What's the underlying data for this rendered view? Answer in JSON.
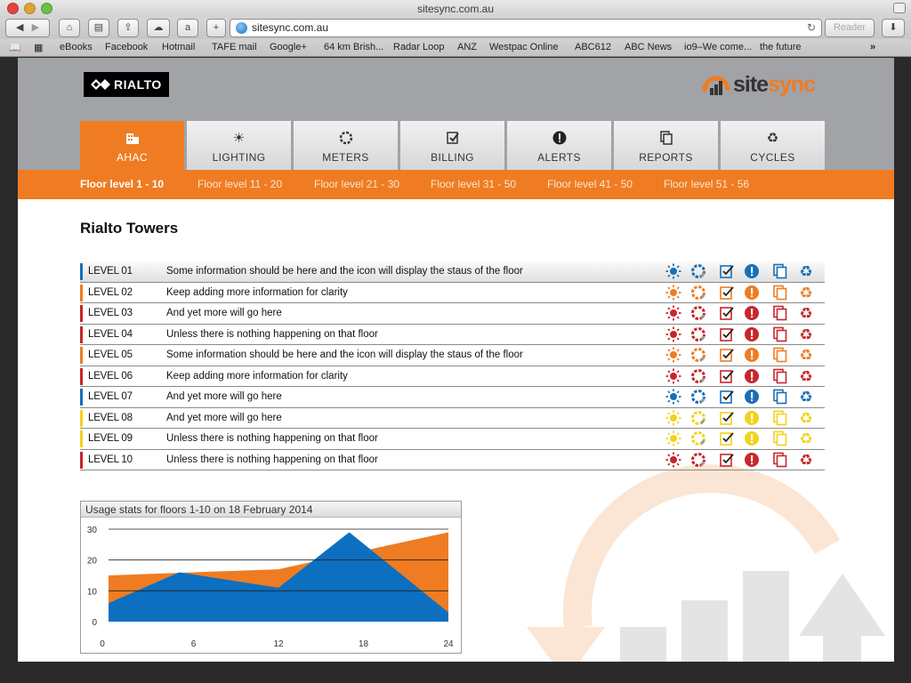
{
  "browser": {
    "window_title": "sitesync.com.au",
    "url": "sitesync.com.au",
    "reader_label": "Reader",
    "bookmarks": [
      "eBooks",
      "Facebook",
      "Hotmail",
      "TAFE mail",
      "Google+",
      "64 km Brish...",
      "Radar Loop",
      "ANZ",
      "Westpac Online",
      "ABC612",
      "ABC News",
      "io9–We come...",
      "the future",
      "»"
    ]
  },
  "header": {
    "client_logo": "RIALTO",
    "brand_logo": {
      "part1": "site",
      "part2": "sync"
    }
  },
  "tabs": [
    {
      "label": "AHAC",
      "icon": "building-icon",
      "active": true
    },
    {
      "label": "LIGHTING",
      "icon": "sun-icon",
      "active": false
    },
    {
      "label": "METERS",
      "icon": "dial-icon",
      "active": false
    },
    {
      "label": "BILLING",
      "icon": "checkbox-icon",
      "active": false
    },
    {
      "label": "ALERTS",
      "icon": "alert-icon",
      "active": false
    },
    {
      "label": "REPORTS",
      "icon": "documents-icon",
      "active": false
    },
    {
      "label": "CYCLES",
      "icon": "recycle-icon",
      "active": false
    }
  ],
  "floor_ranges": [
    "Floor level 1 - 10",
    "Floor level 11 - 20",
    "Floor level 21 - 30",
    "Floor level 31 - 50",
    "Floor level 41 - 50",
    "Floor level 51 - 56"
  ],
  "building_name": "Rialto Towers",
  "levels": [
    {
      "level": "LEVEL 01",
      "info": "Some information should be here and the icon will display the staus of the floor",
      "status_color": "#1a6fb5"
    },
    {
      "level": "LEVEL 02",
      "info": "Keep adding more information for clarity",
      "status_color": "#ef7c22"
    },
    {
      "level": "LEVEL 03",
      "info": "And yet more will go here",
      "status_color": "#c8262b"
    },
    {
      "level": "LEVEL 04",
      "info": "Unless there is nothing happening on that floor",
      "status_color": "#c8262b"
    },
    {
      "level": "LEVEL 05",
      "info": "Some information should be here and the icon will display the staus of the floor",
      "status_color": "#ef7c22"
    },
    {
      "level": "LEVEL 06",
      "info": "Keep adding more information for clarity",
      "status_color": "#c8262b"
    },
    {
      "level": "LEVEL 07",
      "info": "And yet more will go here",
      "status_color": "#1a6fb5"
    },
    {
      "level": "LEVEL 08",
      "info": "And yet more will go here",
      "status_color": "#f2d21c"
    },
    {
      "level": "LEVEL 09",
      "info": "Unless there is nothing happening on that floor",
      "status_color": "#f2d21c"
    },
    {
      "level": "LEVEL 10",
      "info": "Unless there is nothing happening on that floor",
      "status_color": "#c8262b"
    }
  ],
  "status_icons": [
    "sun-icon",
    "dial-icon",
    "checkbox-icon",
    "alert-icon",
    "documents-icon",
    "recycle-icon"
  ],
  "colors": {
    "brand_orange": "#ef7c22",
    "brand_blue": "#0d6fbf",
    "header_grey": "#a1a3a7"
  },
  "chart_data": {
    "type": "area",
    "title": "Usage stats for floors 1-10 on 18 February 2014",
    "x_ticks": [
      0,
      6,
      12,
      18,
      24
    ],
    "y_ticks": [
      0,
      10,
      20,
      30
    ],
    "xlim": [
      0,
      24
    ],
    "ylim": [
      0,
      30
    ],
    "grid": true,
    "series": [
      {
        "color": "#ef7c22",
        "points": [
          [
            0,
            15
          ],
          [
            12,
            17
          ],
          [
            24,
            29
          ]
        ]
      },
      {
        "color": "#0d6fbf",
        "points": [
          [
            0,
            6
          ],
          [
            5,
            16
          ],
          [
            12,
            11
          ],
          [
            17,
            29
          ],
          [
            24,
            3
          ]
        ]
      }
    ]
  }
}
